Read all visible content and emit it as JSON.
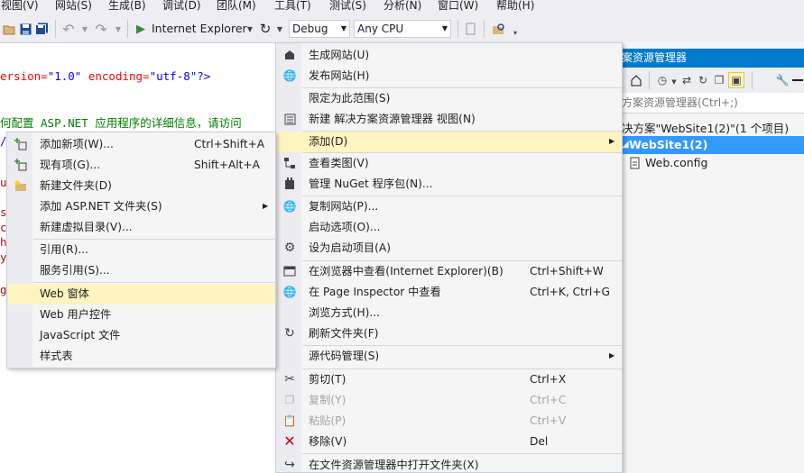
{
  "menubar": [
    "视图(V)",
    "网站(S)",
    "生成(B)",
    "调试(D)",
    "团队(M)",
    "工具(T)",
    "测试(S)",
    "分析(N)",
    "窗口(W)",
    "帮助(H)"
  ],
  "toolbar": {
    "run_label": "Internet Explorer",
    "config_value": "Debug",
    "platform_value": "Any CPU"
  },
  "editor": {
    "line1_attr1": "ersion=",
    "line1_val1": "\"1.0\"",
    "line1_attr2": " encoding=",
    "line1_val2": "\"utf-8\"",
    "line1_end": "?>",
    "comment": "何配置 ASP.NET 应用程序的详细信息，请访问",
    "frag_u": "u",
    "frag_s": "s",
    "frag_c": "c",
    "frag_h": "h",
    "frag_y": "y",
    "frag_g": "g"
  },
  "solution_explorer": {
    "title": "案资源管理器",
    "search_placeholder": "方案资源管理器(Ctrl+;)",
    "solution_label": "决方案\"WebSite1(2)\"(1 个项目)",
    "project_label": "WebSite1(2)",
    "file_label": "Web.config"
  },
  "context_menu": {
    "items": [
      {
        "label": "生成网站(U)",
        "shortcut": "",
        "icon": "build-icon"
      },
      {
        "label": "发布网站(H)",
        "shortcut": "",
        "icon": "publish-globe-icon"
      },
      {
        "label": "限定为此范围(S)",
        "shortcut": "",
        "icon": ""
      },
      {
        "label": "新建 解决方案资源管理器 视图(N)",
        "shortcut": "",
        "icon": "new-view-icon"
      },
      {
        "label": "添加(D)",
        "shortcut": "",
        "icon": ""
      },
      {
        "label": "查看类图(V)",
        "shortcut": "",
        "icon": "class-diagram-icon"
      },
      {
        "label": "管理 NuGet 程序包(N)...",
        "shortcut": "",
        "icon": "nuget-icon"
      },
      {
        "label": "复制网站(P)...",
        "shortcut": "",
        "icon": "copy-website-icon"
      },
      {
        "label": "启动选项(O)...",
        "shortcut": "",
        "icon": ""
      },
      {
        "label": "设为启动项目(A)",
        "shortcut": "",
        "icon": "gear-icon"
      },
      {
        "label": "在浏览器中查看(Internet Explorer)(B)",
        "shortcut": "Ctrl+Shift+W",
        "icon": "browser-view-icon"
      },
      {
        "label": "在 Page Inspector 中查看",
        "shortcut": "Ctrl+K, Ctrl+G",
        "icon": "page-inspector-icon"
      },
      {
        "label": "浏览方式(H)...",
        "shortcut": "",
        "icon": ""
      },
      {
        "label": "刷新文件夹(F)",
        "shortcut": "",
        "icon": "refresh-icon"
      },
      {
        "label": "源代码管理(S)",
        "shortcut": "",
        "icon": ""
      },
      {
        "label": "剪切(T)",
        "shortcut": "Ctrl+X",
        "icon": "cut-icon"
      },
      {
        "label": "复制(Y)",
        "shortcut": "Ctrl+C",
        "icon": "copy-icon"
      },
      {
        "label": "粘贴(P)",
        "shortcut": "Ctrl+V",
        "icon": "paste-icon"
      },
      {
        "label": "移除(V)",
        "shortcut": "Del",
        "icon": "remove-icon"
      },
      {
        "label": "在文件资源管理器中打开文件夹(X)",
        "shortcut": "",
        "icon": "open-folder-icon"
      }
    ]
  },
  "add_submenu": {
    "items": [
      {
        "label": "添加新项(W)...",
        "shortcut": "Ctrl+Shift+A",
        "icon": "add-new-item-icon"
      },
      {
        "label": "现有项(G)...",
        "shortcut": "Shift+Alt+A",
        "icon": "add-existing-item-icon"
      },
      {
        "label": "新建文件夹(D)",
        "shortcut": "",
        "icon": "new-folder-icon"
      },
      {
        "label": "添加 ASP.NET 文件夹(S)",
        "shortcut": "",
        "icon": ""
      },
      {
        "label": "新建虚拟目录(V)...",
        "shortcut": "",
        "icon": ""
      },
      {
        "label": "引用(R)...",
        "shortcut": "",
        "icon": ""
      },
      {
        "label": "服务引用(S)...",
        "shortcut": "",
        "icon": ""
      },
      {
        "label": "Web 窗体",
        "shortcut": "",
        "icon": ""
      },
      {
        "label": "Web 用户控件",
        "shortcut": "",
        "icon": ""
      },
      {
        "label": "JavaScript 文件",
        "shortcut": "",
        "icon": ""
      },
      {
        "label": "样式表",
        "shortcut": "",
        "icon": ""
      }
    ]
  },
  "colors": {
    "accent": "#007acc",
    "highlight": "#fdf4bf",
    "code_blue": "#0000ff",
    "code_red": "#a31515",
    "code_green": "#008000"
  }
}
